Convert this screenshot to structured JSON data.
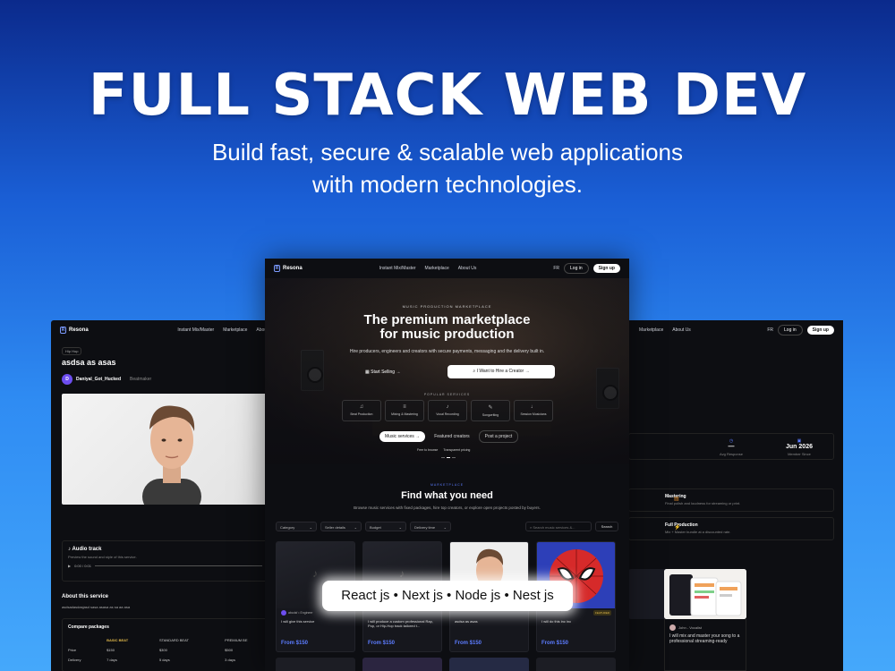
{
  "hero": {
    "title": "FULL STACK WEB DEV",
    "subtitle_line1": "Build fast, secure & scalable web applications",
    "subtitle_line2": "with modern technologies."
  },
  "tech_pill": "React js • Next js • Node js • Nest js",
  "colors": {
    "accent": "#5c7cff",
    "gold": "#e0b84a",
    "bg_dark": "#0d0e12"
  },
  "left_screen": {
    "brand": "Resona",
    "nav": [
      "Instant Mix/Master",
      "Marketplace",
      "About Us"
    ],
    "tag": "Hip Hop",
    "title": "asdsa as asas",
    "seller_initial": "D",
    "seller_name": "Daniyal_Got_Hucked",
    "seller_role": "Beatmaker",
    "audio_title": "Audio track",
    "audio_desc": "Preview the sound and style of this service.",
    "audio_time": "0:00 / 0:01",
    "about_title": "About this service",
    "about_text": "asdsadasdasjasd sasa asasa as sa  aa asa",
    "packages_title": "Compare packages",
    "packages_headers": [
      "",
      "BASIC BEAT",
      "STANDARD BEAT",
      "PREMIUM BE"
    ],
    "packages_rows": [
      [
        "Price",
        "$150",
        "$300",
        "$500"
      ],
      [
        "Delivery",
        "7 days",
        "5 days",
        "3 days"
      ]
    ]
  },
  "center_screen": {
    "brand": "Resona",
    "nav": [
      "Instant Mix/Master",
      "Marketplace",
      "About Us"
    ],
    "lang": "FR",
    "login": "Log in",
    "signup": "Sign up",
    "kicker": "MUSIC PRODUCTION MARKETPLACE",
    "title_line1": "The premium marketplace",
    "title_line2": "for music production",
    "desc": "Hire producers, engineers and creators with secure payments, messaging and the delivery built in.",
    "start_selling": "Start Selling",
    "hire_creator": "I Want to Hire a Creator",
    "popular": "POPULAR SERVICES",
    "categories": [
      "Beat Production",
      "Mixing & Mastering",
      "Vocal Recording",
      "Songwriting",
      "Session Musicians"
    ],
    "tabs": [
      "Music services",
      "Featured creators",
      "Post a project"
    ],
    "notes": [
      "Free to browse",
      "Transparent pricing"
    ],
    "market_kicker": "MARKETPLACE",
    "market_title": "Find what you need",
    "market_desc": "Browse music services with fixed packages, hire top creators, or explore open projects posted by buyers.",
    "filters": [
      "Category",
      "Seller details",
      "Budget",
      "Delivery time"
    ],
    "search_placeholder": "Search music services &...",
    "search_btn": "Search",
    "cards": [
      {
        "seller": "abcdsf • Engineer",
        "title": "I will give this service",
        "price": "From $150"
      },
      {
        "seller": "",
        "title": "I will produce a custom professional Rap, Pop, or Hip-Hop track tailored t...",
        "price": "From $150"
      },
      {
        "seller": "",
        "title": "asdsa as asas",
        "price": "From $150"
      },
      {
        "seller": "",
        "title": "I will do this inc inc",
        "price": "From $150",
        "badge": "FEATURED"
      }
    ]
  },
  "right_screen": {
    "nav": [
      "Marketplace",
      "About Us"
    ],
    "lang": "FR",
    "login": "Log in",
    "signup": "Sign up",
    "stats": [
      {
        "value": "",
        "label": ""
      },
      {
        "value": "—",
        "label": "Avg Response"
      },
      {
        "value": "Jun 2026",
        "label": "Member Since"
      }
    ],
    "services": [
      {
        "title": "Mastering",
        "desc": "Final polish and loudness for streaming or print."
      },
      {
        "title": "Full Production",
        "desc": "Mix + Master bundle at a discounted rate."
      }
    ],
    "review_name": "John - Vocalist",
    "review_text": "I will mix and master your song to a professional streaming-ready"
  }
}
